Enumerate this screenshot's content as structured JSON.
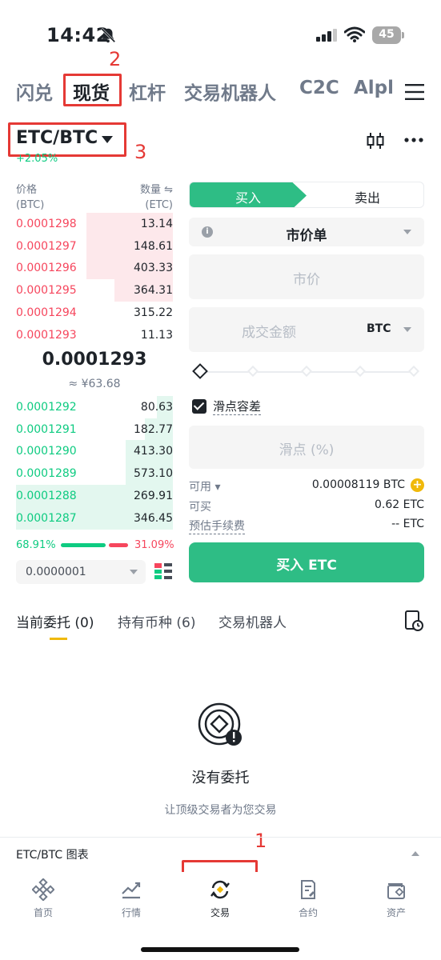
{
  "status_bar": {
    "time": "14:42",
    "battery": "45"
  },
  "top_tabs": [
    "闪兑",
    "现货",
    "杠杆",
    "交易机器人",
    "C2C",
    "Alph"
  ],
  "annotations": [
    "1",
    "2",
    "3"
  ],
  "pair": {
    "symbol": "ETC/BTC",
    "change": "+2.05%"
  },
  "order_book": {
    "price_header": "价格",
    "price_unit": "(BTC)",
    "qty_header": "数量 ⇋",
    "qty_unit": "(ETC)",
    "asks": [
      {
        "price": "0.0001298",
        "qty": "13.14",
        "depth": 0.55
      },
      {
        "price": "0.0001297",
        "qty": "148.61",
        "depth": 0.55
      },
      {
        "price": "0.0001296",
        "qty": "403.33",
        "depth": 0.55
      },
      {
        "price": "0.0001295",
        "qty": "364.31",
        "depth": 0.37
      },
      {
        "price": "0.0001294",
        "qty": "315.22",
        "depth": 0.0
      },
      {
        "price": "0.0001293",
        "qty": "11.13",
        "depth": 0.0
      }
    ],
    "last_price": "0.0001293",
    "last_price_cny": "≈ ¥63.68",
    "bids": [
      {
        "price": "0.0001292",
        "qty": "80.63",
        "depth": 0.1
      },
      {
        "price": "0.0001291",
        "qty": "182.77",
        "depth": 0.18
      },
      {
        "price": "0.0001290",
        "qty": "413.30",
        "depth": 0.3
      },
      {
        "price": "0.0001289",
        "qty": "573.10",
        "depth": 0.3
      },
      {
        "price": "0.0001288",
        "qty": "269.91",
        "depth": 1.0
      },
      {
        "price": "0.0001287",
        "qty": "346.45",
        "depth": 1.0
      }
    ],
    "buy_ratio": "68.91%",
    "sell_ratio": "31.09%",
    "precision": "0.0000001"
  },
  "trade_form": {
    "buy_label": "买入",
    "sell_label": "卖出",
    "order_type": "市价单",
    "market_price_placeholder": "市价",
    "amount_placeholder": "成交金额",
    "amount_unit": "BTC",
    "slippage_label": "滑点容差",
    "slippage_placeholder": "滑点 (%)",
    "available_label": "可用 ▾",
    "available_value": "0.00008119 BTC",
    "can_buy_label": "可买",
    "can_buy_value": "0.62 ETC",
    "fee_label": "预估手续费",
    "fee_value": "-- ETC",
    "submit_label": "买入 ETC"
  },
  "order_tabs": [
    "当前委托 (0)",
    "持有币种 (6)",
    "交易机器人"
  ],
  "empty_state": {
    "title": "没有委托",
    "subtitle": "让顶级交易者为您交易"
  },
  "chart_bar": {
    "label": "ETC/BTC 图表"
  },
  "bottom_nav": [
    "首页",
    "行情",
    "交易",
    "合约",
    "资产"
  ],
  "colors": {
    "buy": "#2ebd85",
    "sell": "#f6465d",
    "accent": "#f0b90b",
    "annotation": "#e53935"
  }
}
